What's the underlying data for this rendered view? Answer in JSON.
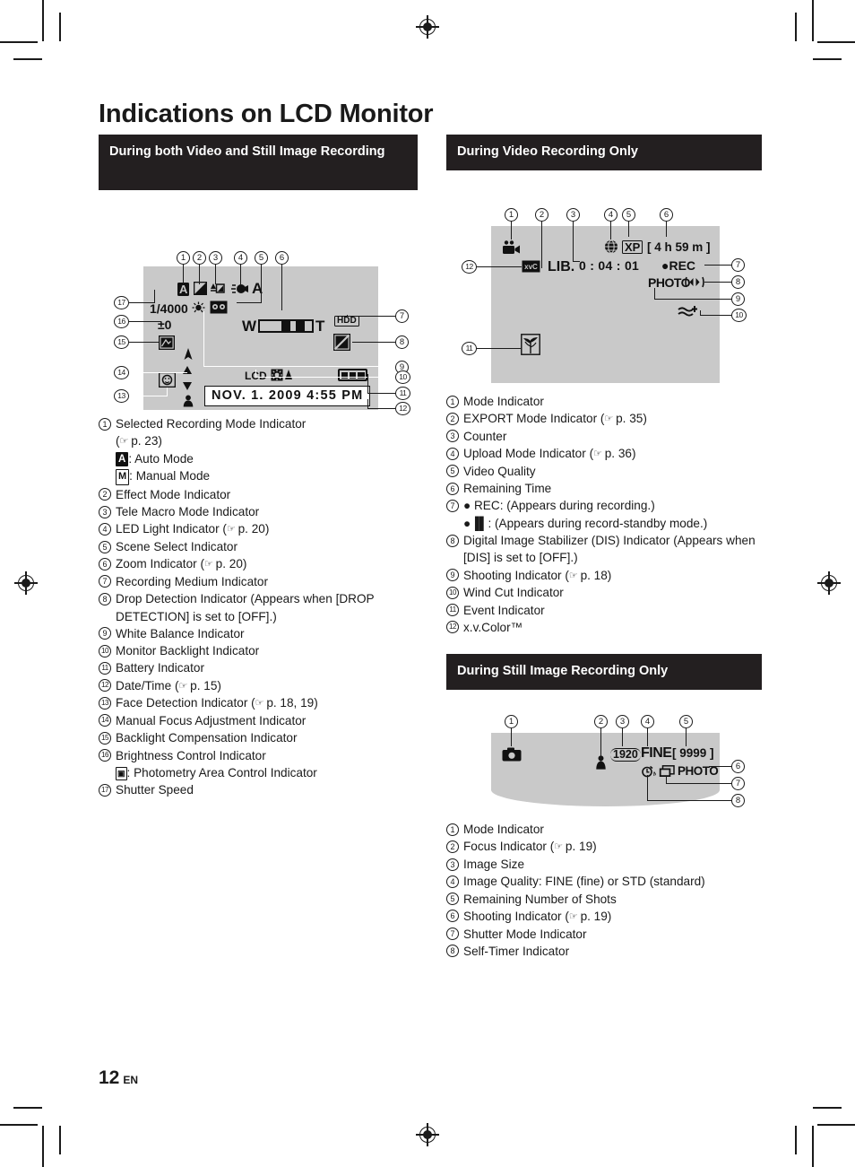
{
  "document": {
    "title": "Indications on LCD Monitor",
    "page_number": "12",
    "page_language": "EN"
  },
  "sections": {
    "both": {
      "heading": "During both Video and Still Image Recording",
      "lcd": {
        "shutter_speed": "1/4000",
        "brightness": "±0",
        "auto_mode_letter": "A",
        "led_letter": "A",
        "zoom_w": "W",
        "zoom_t": "T",
        "medium": "HDD",
        "lcd_label": "LCD",
        "date": "NOV. 1. 2009",
        "time": "4:55 PM",
        "date_time_combined": "NOV. 1. 2009    4:55 PM"
      },
      "callouts": [
        "1",
        "2",
        "3",
        "4",
        "5",
        "6",
        "7",
        "8",
        "9",
        "10",
        "11",
        "12",
        "13",
        "14",
        "15",
        "16",
        "17"
      ],
      "legend": [
        {
          "n": "1",
          "text": "Selected Recording Mode Indicator",
          "ref": "p. 23",
          "subs": [
            {
              "badge": "A",
              "badge_style": "dark",
              "text": ": Auto Mode"
            },
            {
              "badge": "M",
              "badge_style": "light",
              "text": ": Manual Mode"
            }
          ]
        },
        {
          "n": "2",
          "text": "Effect Mode Indicator"
        },
        {
          "n": "3",
          "text": "Tele Macro Mode Indicator"
        },
        {
          "n": "4",
          "text": "LED Light Indicator",
          "ref": "p. 20"
        },
        {
          "n": "5",
          "text": "Scene Select Indicator"
        },
        {
          "n": "6",
          "text": "Zoom Indicator",
          "ref": "p. 20"
        },
        {
          "n": "7",
          "text": "Recording Medium Indicator"
        },
        {
          "n": "8",
          "text": "Drop Detection Indicator (Appears when [DROP DETECTION] is set to [OFF].)"
        },
        {
          "n": "9",
          "text": "White Balance Indicator"
        },
        {
          "n": "10",
          "text": "Monitor Backlight Indicator"
        },
        {
          "n": "11",
          "text": "Battery Indicator"
        },
        {
          "n": "12",
          "text": "Date/Time",
          "ref": "p. 15"
        },
        {
          "n": "13",
          "text": "Face Detection Indicator",
          "ref": "p. 18, 19"
        },
        {
          "n": "14",
          "text": "Manual Focus Adjustment Indicator"
        },
        {
          "n": "15",
          "text": "Backlight Compensation Indicator"
        },
        {
          "n": "16",
          "text": "Brightness Control Indicator",
          "subs": [
            {
              "badge": "▣",
              "badge_style": "light",
              "text": ": Photometry Area Control Indicator"
            }
          ]
        },
        {
          "n": "17",
          "text": "Shutter Speed"
        }
      ]
    },
    "video": {
      "heading": "During Video Recording Only",
      "lcd": {
        "export_label": "LIB.",
        "xvcolor_badge": "xvC",
        "quality": "XP",
        "remaining_time": "[ 4 h 59 m ]",
        "counter": "0 : 04 : 01",
        "rec": "●REC",
        "photo": "PHOTO"
      },
      "callouts": [
        "1",
        "2",
        "3",
        "4",
        "5",
        "6",
        "7",
        "8",
        "9",
        "10",
        "11",
        "12"
      ],
      "legend": [
        {
          "n": "1",
          "text": "Mode Indicator"
        },
        {
          "n": "2",
          "text": "EXPORT Mode Indicator",
          "ref": "p. 35"
        },
        {
          "n": "3",
          "text": "Counter"
        },
        {
          "n": "4",
          "text": "Upload Mode Indicator",
          "ref": "p. 36"
        },
        {
          "n": "5",
          "text": "Video Quality"
        },
        {
          "n": "6",
          "text": "Remaining Time"
        },
        {
          "n": "7",
          "text": "● REC: (Appears during recording.)",
          "subs": [
            {
              "badge": "",
              "text": "●▐▌: (Appears during record-standby mode.)"
            }
          ]
        },
        {
          "n": "8",
          "text": "Digital Image Stabilizer (DIS) Indicator (Appears when [DIS] is set to [OFF].)"
        },
        {
          "n": "9",
          "text": "Shooting Indicator",
          "ref": "p. 18"
        },
        {
          "n": "10",
          "text": "Wind Cut Indicator"
        },
        {
          "n": "11",
          "text": "Event Indicator"
        },
        {
          "n": "12",
          "text": "x.v.Color™"
        }
      ]
    },
    "still": {
      "heading": "During Still Image Recording Only",
      "lcd": {
        "image_size": "1920",
        "quality": "FINE",
        "remaining_shots": "[ 9999 ]",
        "photo": "PHOTO"
      },
      "callouts": [
        "1",
        "2",
        "3",
        "4",
        "5",
        "6",
        "7",
        "8"
      ],
      "legend": [
        {
          "n": "1",
          "text": "Mode Indicator"
        },
        {
          "n": "2",
          "text": "Focus Indicator",
          "ref": "p. 19"
        },
        {
          "n": "3",
          "text": "Image Size"
        },
        {
          "n": "4",
          "text": "Image Quality: FINE (fine) or STD (standard)"
        },
        {
          "n": "5",
          "text": "Remaining Number of Shots"
        },
        {
          "n": "6",
          "text": "Shooting Indicator",
          "ref": "p. 19"
        },
        {
          "n": "7",
          "text": "Shutter Mode Indicator"
        },
        {
          "n": "8",
          "text": "Self-Timer Indicator"
        }
      ]
    }
  },
  "colors": {
    "bar_background": "#231f20",
    "lcd_background": "#c9c9c9",
    "text": "#1a1a1a"
  }
}
